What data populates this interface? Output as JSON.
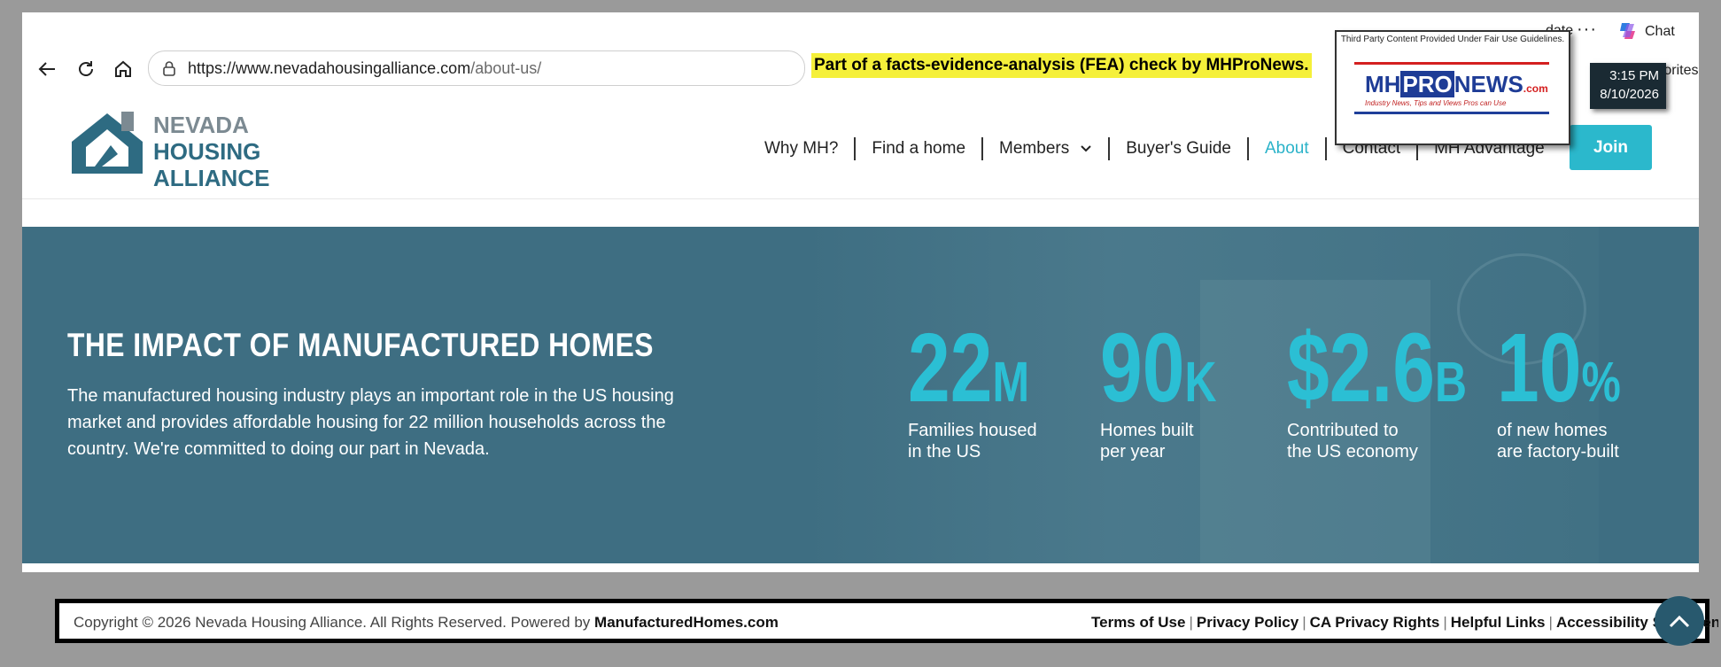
{
  "browser": {
    "url_host": "https://www.nevadahousingalliance.com",
    "url_path": "/about-us/",
    "fea_banner": "Part of a facts-evidence-analysis (FEA) check by MHProNews.",
    "update_label": "date",
    "more_label": "···",
    "chat_label": "Chat",
    "favorites_label": "favorites"
  },
  "clock": {
    "time": "3:15 PM",
    "date": "8/10/2026"
  },
  "fairuse": {
    "note": "Third Party Content Provided Under Fair Use Guidelines.",
    "logo_mh": "MH",
    "logo_pro": "PRO",
    "logo_news": "NEWS",
    "logo_com": ".com",
    "tagline": "Industry News, Tips and Views Pros can Use"
  },
  "site": {
    "logo_line1": "NEVADA",
    "logo_line2": "HOUSING",
    "logo_line3": "ALLIANCE",
    "menu": [
      "Why MH?",
      "Find a home",
      "Members",
      "Buyer's Guide",
      "About",
      "Contact",
      "MH Advantage"
    ],
    "join_label": "Join"
  },
  "hero": {
    "title": "THE IMPACT OF MANUFACTURED HOMES",
    "description": "The manufactured housing industry plays an important role in the US housing market and provides affordable housing for 22 million households across the country. We're committed to doing our part in Nevada.",
    "stats": [
      {
        "value": "22",
        "unit": "M",
        "label": "Families housed\nin the US"
      },
      {
        "value": "90",
        "unit": "K",
        "label": "Homes built\nper year"
      },
      {
        "value": "$2.6",
        "unit": "B",
        "label": "Contributed to\nthe US economy"
      },
      {
        "value": "10",
        "unit": "%",
        "label": "of new homes\nare factory-built"
      }
    ]
  },
  "footer": {
    "copyright": "Copyright © 2026 Nevada Housing Alliance. All Rights Reserved. Powered by",
    "powered_by": "ManufacturedHomes.com",
    "links": [
      "Terms of Use",
      "Privacy Policy",
      "CA Privacy Rights",
      "Helpful Links",
      "Accessibility Statement"
    ]
  },
  "colors": {
    "accent": "#2bb8cc",
    "hero_bg": "#3e6e82",
    "brand_dark": "#2e6b82"
  }
}
